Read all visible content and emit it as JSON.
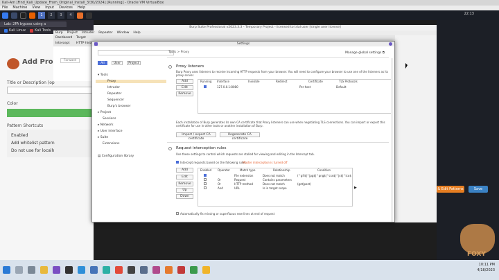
{
  "vbox": {
    "title": "Kali-Am [Find_Kali_Update_From_Original_Install_3/30/2024] [Running] - Oracle VM VirtualBox",
    "menu": [
      "File",
      "Machine",
      "View",
      "Input",
      "Devices",
      "Help"
    ]
  },
  "kali": {
    "workspaces": [
      "1",
      "2",
      "3",
      "4"
    ],
    "clock": "22:13"
  },
  "browser": {
    "tab_label": "Lab: 2FA bypass using a",
    "bookmarks": [
      "Kali Linux",
      "Kali Tools"
    ]
  },
  "foxy": {
    "title": "Add Prox",
    "title_label": "Title or Description (op",
    "color_label": "Color",
    "color_value": "#5cb85c",
    "patterns_label": "Pattern Shortcuts",
    "patterns": [
      "Enabled",
      "Add whitelist pattern",
      "Do not use for localh"
    ],
    "edit_patterns": "& Edit Patterns",
    "save": "Save",
    "mascot_text": "FOXY"
  },
  "burp": {
    "title": "Burp Suite Professional v2023.3.3 - Temporary Project - licensed to trial user [single user license]",
    "menu": [
      "Burp",
      "Project",
      "Intruder",
      "Repeater",
      "Window",
      "Help"
    ],
    "tabs": [
      "Dashboard",
      "Target"
    ],
    "subtabs": [
      "Intercept",
      "HTTP histo"
    ],
    "forward_label": "Forward",
    "settings_label": "Settings"
  },
  "settings": {
    "title": "Settings",
    "breadcrumb": "Tools  >  Proxy",
    "manage_global": "Manage global settings",
    "scope_buttons": [
      "All",
      "User",
      "Project"
    ],
    "tree": [
      "Tools",
      "Proxy",
      "Intruder",
      "Repeater",
      "Sequencer",
      "Burp's browser",
      "Project",
      "Sessions",
      "Network",
      "User interface",
      "Suite",
      "Extensions"
    ],
    "config_library": "Configuration library",
    "proxy_listeners": {
      "title": "Proxy listeners",
      "description": "Burp Proxy uses listeners to receive incoming HTTP requests from your browser. You will need to configure your browser to use one of the listeners as its proxy server.",
      "buttons": [
        "Add",
        "Edit",
        "Remove"
      ],
      "columns": [
        "Running",
        "Interface",
        "Invisible",
        "Redirect",
        "Certificate",
        "TLS Protocols"
      ],
      "rows": [
        {
          "interface": "127.0.0.1:8080",
          "certificate": "Per-host",
          "tls": "Default"
        }
      ],
      "ca_text": "Each installation of Burp generates its own CA certificate that Proxy listeners can use when negotiating TLS connections. You can import or export this certificate for use in other tools or another installation of Burp.",
      "import_export": "Import / export CA certificate",
      "regenerate": "Regenerate CA certificate"
    },
    "interception": {
      "title": "Request interception rules",
      "description": "Use these settings to control which requests are stalled for viewing and editing in the Intercept tab.",
      "intercept_label": "Intercept requests based on the following rules:",
      "intercept_status": "Master interception is turned off",
      "buttons": [
        "Add",
        "Edit",
        "Remove",
        "Up",
        "Down"
      ],
      "columns": [
        "Enabled",
        "Operator",
        "Match type",
        "Relationship",
        "Condition"
      ],
      "rules": [
        {
          "enabled": true,
          "operator": "",
          "match": "File extension",
          "relationship": "Does not match",
          "condition": "(^gif$|^jpg$|^png$|^css$|^js$|^ico$|^sv"
        },
        {
          "enabled": false,
          "operator": "Or",
          "match": "Request",
          "relationship": "Contains parameters",
          "condition": ""
        },
        {
          "enabled": false,
          "operator": "Or",
          "match": "HTTP method",
          "relationship": "Does not match",
          "condition": "(get|post)"
        },
        {
          "enabled": false,
          "operator": "And",
          "match": "URL",
          "relationship": "Is in target scope",
          "condition": ""
        }
      ],
      "auto_fix": "Automatically fix missing or superfluous new lines at end of request"
    }
  },
  "taskbar": {
    "time": "10:11 PM",
    "date": "4/18/2023"
  }
}
